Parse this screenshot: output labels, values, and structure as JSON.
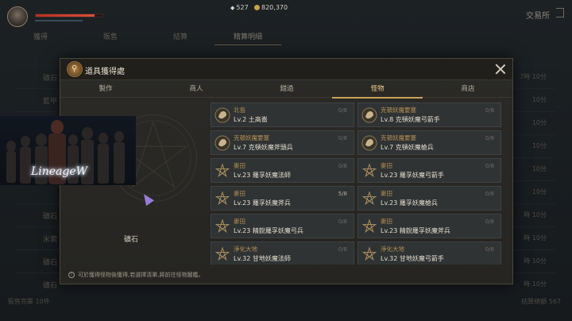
{
  "hud": {
    "hp_fraction": 0.88,
    "gems": "527",
    "gold": "820,370",
    "exchange_label": "交易所"
  },
  "background": {
    "tabs": [
      "獲得",
      "販售",
      "結算",
      "精算明細"
    ],
    "rows": [
      {
        "label": "礦石",
        "time": "7時 10分"
      },
      {
        "label": "藍甲",
        "time": "10分"
      },
      {
        "label": "",
        "time": "10分"
      },
      {
        "label": "",
        "time": "10分"
      },
      {
        "label": "",
        "time": "10分"
      },
      {
        "label": "",
        "time": "10分"
      },
      {
        "label": "礦石",
        "time": "時 10分"
      },
      {
        "label": "米索",
        "time": "時 10分"
      },
      {
        "label": "礦石",
        "time": "時 10分"
      },
      {
        "label": "礦石",
        "time": "時 10分"
      }
    ],
    "footer_left": "販售完畢  10件",
    "footer_right": "結算總額  567"
  },
  "modal": {
    "title": "道具獲得處",
    "tabs": [
      "製作",
      "商人",
      "錯過",
      "怪物",
      "商店"
    ],
    "active_tab": 3,
    "item_name": "礦石",
    "footer_note": "可於獲得怪物後獲得,若選擇清單,將前往怪物圖鑑。",
    "monsters": [
      {
        "location": "北島",
        "name": "Lv.2 土高崙",
        "count": "0/8",
        "icon": "beast"
      },
      {
        "location": "克頓妖魔要塞",
        "name": "Lv.8 克頓妖魔弓箭手",
        "count": "0/8",
        "icon": "beast"
      },
      {
        "location": "克頓妖魔要塞",
        "name": "Lv.7 克頓妖魔斧頭兵",
        "count": "0/8",
        "icon": "beast"
      },
      {
        "location": "克頓妖魔要塞",
        "name": "Lv.7 克頓妖魔槍兵",
        "count": "0/8",
        "icon": "beast"
      },
      {
        "location": "麥田",
        "name": "Lv.23 羅孚妖魔法師",
        "count": "0/8",
        "icon": "pentagram"
      },
      {
        "location": "麥田",
        "name": "Lv.23 羅孚妖魔弓箭手",
        "count": "0/8",
        "icon": "pentagram"
      },
      {
        "location": "麥田",
        "name": "Lv.23 羅孚妖魔斧兵",
        "count": "5/8",
        "icon": "pentagram"
      },
      {
        "location": "麥田",
        "name": "Lv.23 羅孚妖魔槍兵",
        "count": "0/8",
        "icon": "pentagram"
      },
      {
        "location": "麥田",
        "name": "Lv.23 精銳羅孚妖魔弓兵",
        "count": "0/8",
        "icon": "pentagram"
      },
      {
        "location": "麥田",
        "name": "Lv.23 精銳羅孚妖魔斧兵",
        "count": "0/8",
        "icon": "pentagram"
      },
      {
        "location": "淨化大地",
        "name": "Lv.32 甘地妖魔法師",
        "count": "0/8",
        "icon": "pentagram"
      },
      {
        "location": "淨化大地",
        "name": "Lv.32 甘地妖魔弓箭手",
        "count": "0/8",
        "icon": "pentagram"
      }
    ]
  },
  "overlay_logo": "LineageW"
}
